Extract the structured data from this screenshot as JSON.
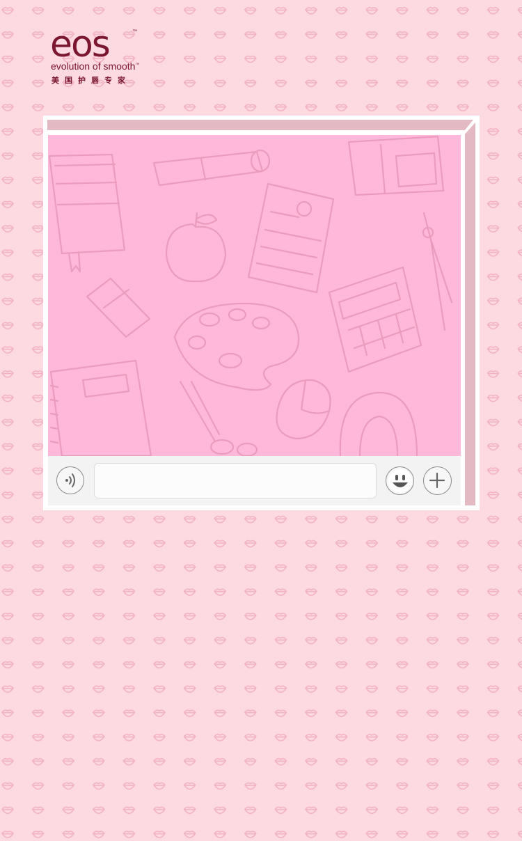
{
  "brand": {
    "logo_mark": "eos",
    "tm": "™",
    "tagline": "evolution of smooth",
    "subtitle": "美国护唇专家",
    "color": "#7a1630"
  },
  "colors": {
    "page_background": "#fdd9e1",
    "pattern_mark": "#f2b2c4",
    "frame_band": "#e3b9c4",
    "screen_background": "#ffb8d9",
    "doodle_stroke": "#eb9bbd",
    "chat_bar_background": "#f3f3f3"
  },
  "chat_bar": {
    "voice_icon": "voice-wave-icon",
    "input_value": "",
    "input_placeholder": "",
    "emoji_icon": "smiley-face-icon",
    "plus_icon": "plus-icon"
  },
  "screen": {
    "doodle_icons": [
      "book-icon",
      "scroll-icon",
      "backpack-icon",
      "apple-icon",
      "document-icon",
      "compass-icon",
      "eraser-icon",
      "paint-palette-icon",
      "calculator-icon",
      "notebook-icon",
      "scissors-icon",
      "mouse-icon",
      "protractor-icon"
    ]
  }
}
